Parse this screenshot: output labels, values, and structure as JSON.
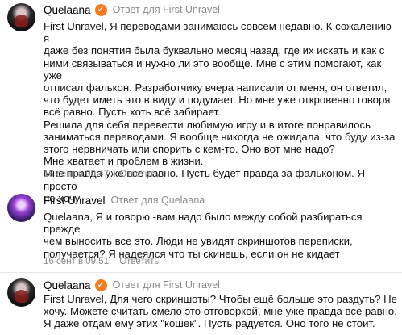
{
  "comments": [
    {
      "author": "Quelaana",
      "verified": true,
      "reply_to": "Ответ для First Unravel",
      "text": "First Unravel, Я переводами занимаюсь совсем недавно. К сожалению я\nдаже без понятия была буквально месяц назад, где их искать и как с\nними связываться и нужно ли это вообще. Мне с этим помогают, как уже\nотписал фалькон. Разработчику вчера написали от меня, он ответил,\nчто будет иметь это в виду и подумает. Но мне уже откровенно говоря\nвсё равно. Пусть хоть всё забирает.\nРешила для себя перевести любимую игру и в итоге понравилось\nзаниматься переводами. Я вообще никогда не ожидала, что буду из-за\nэтого нервничать или спорить с кем-то. Оно вот мне надо?\nМне хватает и проблем в жизни.\nМне правда уже всё равно. Пусть будет правда за фальконом. Я просто\nне хочу.",
      "date": "16 сент в 09:47",
      "reply_label": "Ответить"
    },
    {
      "author": "First Unravel",
      "verified": false,
      "reply_to": "Ответ для Quelaana",
      "text": "Quelaana, Я и говорю -вам надо было между собой разбираться прежде\nчем выносить все это. Люди не увидят скриншотов переписки,\nполучается? Я надеялся что ты скинешь, если он не кидает",
      "date": "16 сент в 09:51",
      "reply_label": "Ответить"
    },
    {
      "author": "Quelaana",
      "verified": true,
      "reply_to": "Ответ для First Unravel",
      "text": "First Unravel, Для чего скриншоты? Чтобы ещё больше это раздуть? Не\nхочу. Можете считать смело это отговоркой, мне уже правда всё равно.\nЯ даже отдам ему этих \"кошек\". Пусть радуется. Оно того не стоит.",
      "date": "",
      "reply_label": ""
    }
  ]
}
